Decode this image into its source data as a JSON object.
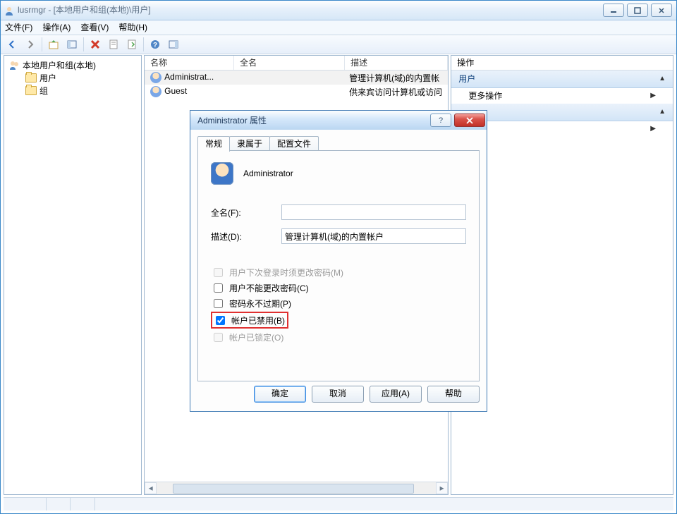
{
  "window": {
    "title": "lusrmgr - [本地用户和组(本地)\\用户]"
  },
  "menu": {
    "file": "文件(F)",
    "action": "操作(A)",
    "view": "查看(V)",
    "help": "帮助(H)"
  },
  "tree": {
    "root": "本地用户和组(本地)",
    "users": "用户",
    "groups": "组"
  },
  "list": {
    "cols": {
      "name": "名称",
      "fullname": "全名",
      "desc": "描述"
    },
    "rows": [
      {
        "name": "Administrat...",
        "full": "",
        "desc": "管理计算机(域)的内置帐"
      },
      {
        "name": "Guest",
        "full": "",
        "desc": "供来宾访问计算机或访问"
      }
    ]
  },
  "actions": {
    "header": "操作",
    "section1": "用户",
    "item1": "更多操作"
  },
  "dialog": {
    "title": "Administrator 属性",
    "tabs": {
      "general": "常规",
      "memberof": "隶属于",
      "profile": "配置文件"
    },
    "username": "Administrator",
    "fullname_label": "全名(F):",
    "fullname_value": "",
    "desc_label": "描述(D):",
    "desc_value": "管理计算机(域)的内置帐户",
    "cb_mustchange": "用户下次登录时须更改密码(M)",
    "cb_cannotchange": "用户不能更改密码(C)",
    "cb_neverexpire": "密码永不过期(P)",
    "cb_disabled": "帐户已禁用(B)",
    "cb_locked": "帐户已锁定(O)",
    "btn_ok": "确定",
    "btn_cancel": "取消",
    "btn_apply": "应用(A)",
    "btn_help": "帮助"
  }
}
